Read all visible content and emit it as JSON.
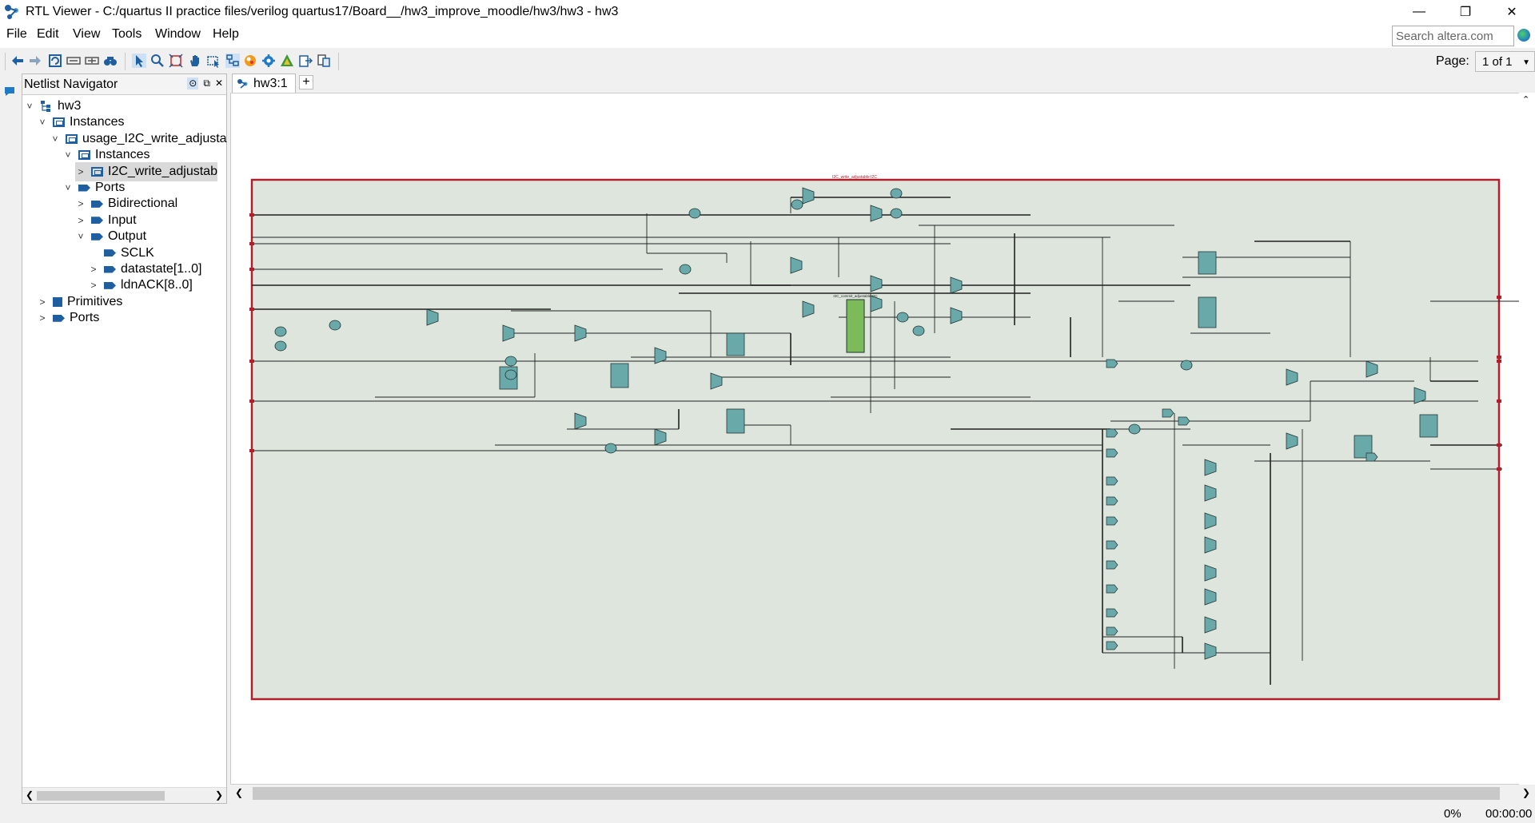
{
  "window": {
    "title": "RTL Viewer - C:/quartus II practice files/verilog quartus17/Board__/hw3_improve_moodle/hw3/hw3 - hw3",
    "controls": [
      "minimize",
      "restore",
      "close"
    ]
  },
  "menu": {
    "items": [
      "File",
      "Edit",
      "View",
      "Tools",
      "Window",
      "Help"
    ]
  },
  "search": {
    "placeholder": "Search altera.com"
  },
  "toolbar": {
    "icons": [
      "back-icon",
      "forward-icon",
      "refresh-icon",
      "collapse-icon",
      "expand-icon",
      "find-icon",
      "select-icon",
      "zoom-icon",
      "fit-icon",
      "hand-icon",
      "area-select-icon",
      "netlist-icon",
      "color-icon",
      "settings-icon",
      "filter-icon",
      "export-icon",
      "page-icon"
    ],
    "page_label": "Page:",
    "page_value": "1 of 1"
  },
  "navigator": {
    "title": "Netlist Navigator",
    "tree": [
      {
        "label": "hw3",
        "level": 0,
        "icon": "hierarchy",
        "expanded": true
      },
      {
        "label": "Instances",
        "level": 1,
        "icon": "instance",
        "expanded": true
      },
      {
        "label": "usage_I2C_write_adjusta",
        "level": 2,
        "icon": "instance",
        "expanded": true
      },
      {
        "label": "Instances",
        "level": 3,
        "icon": "instance",
        "expanded": true
      },
      {
        "label": "I2C_write_adjustab",
        "level": 4,
        "icon": "instance",
        "expanded": false,
        "selected": true
      },
      {
        "label": "Ports",
        "level": 3,
        "icon": "port",
        "expanded": true
      },
      {
        "label": "Bidirectional",
        "level": 4,
        "icon": "port",
        "expanded": false
      },
      {
        "label": "Input",
        "level": 4,
        "icon": "port",
        "expanded": false
      },
      {
        "label": "Output",
        "level": 4,
        "icon": "port",
        "expanded": true
      },
      {
        "label": "SCLK",
        "level": 5,
        "icon": "port",
        "leaf": true
      },
      {
        "label": "datastate[1..0]",
        "level": 5,
        "icon": "port",
        "expanded": false
      },
      {
        "label": "ldnACK[8..0]",
        "level": 5,
        "icon": "port",
        "expanded": false
      },
      {
        "label": "Primitives",
        "level": 1,
        "icon": "primitive",
        "expanded": false
      },
      {
        "label": "Ports",
        "level": 1,
        "icon": "port",
        "expanded": false
      }
    ]
  },
  "tabs": [
    {
      "label": "hw3:1"
    }
  ],
  "diagram": {
    "module_label": "I2C_write_adjustable:I2C",
    "inner_instance_label": "I2C_commit_adjustable:I2C"
  },
  "status": {
    "progress": "0%",
    "time": "00:00:00"
  },
  "colors": {
    "frame": "#b0202c",
    "canvas_fill": "#dde5dd",
    "block_fill": "#6aa9a9",
    "instance_fill": "#7dbb5a",
    "accent": "#1f5fa0"
  }
}
